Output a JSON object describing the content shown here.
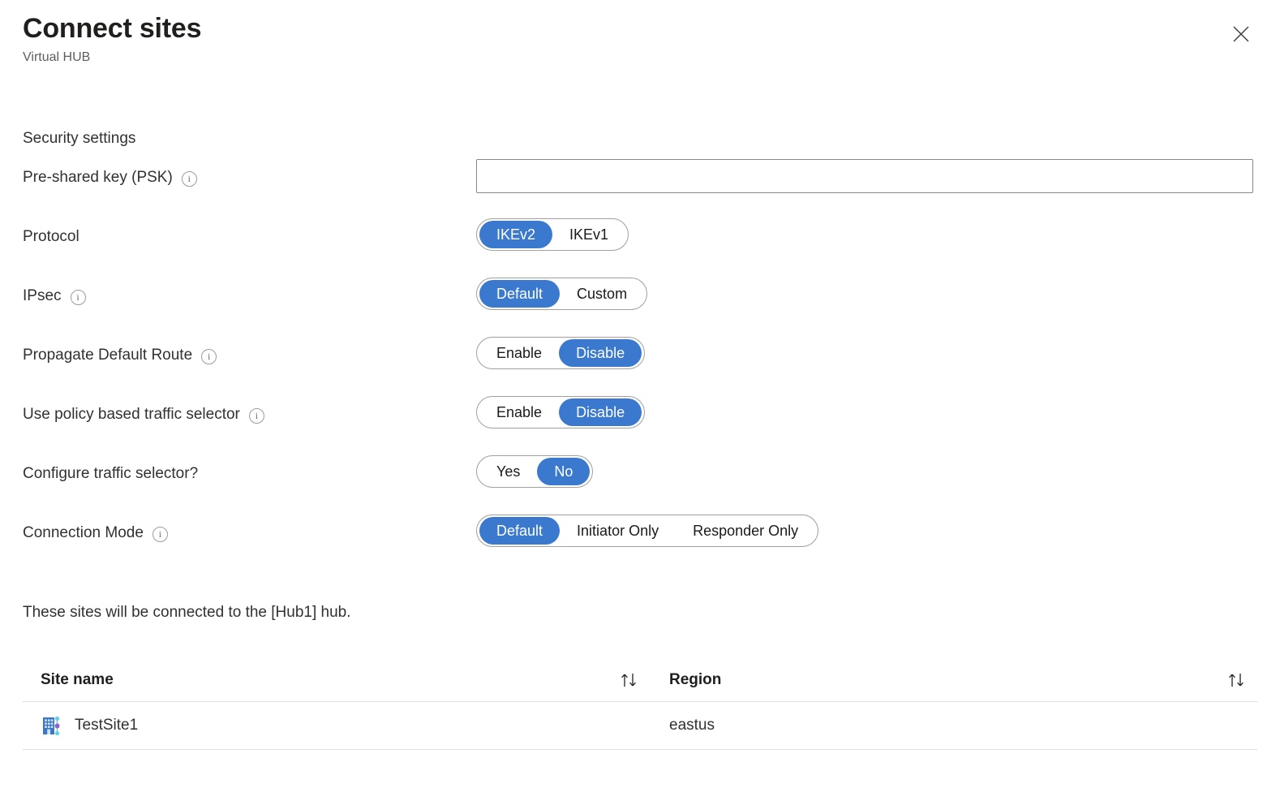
{
  "header": {
    "title": "Connect sites",
    "subtitle": "Virtual HUB",
    "close_label": "Close"
  },
  "section": {
    "heading": "Security settings"
  },
  "fields": {
    "psk": {
      "label": "Pre-shared key (PSK)",
      "value": "",
      "placeholder": "",
      "info": "i"
    },
    "protocol": {
      "label": "Protocol",
      "options": [
        "IKEv2",
        "IKEv1"
      ],
      "selected": "IKEv2"
    },
    "ipsec": {
      "label": "IPsec",
      "info": "i",
      "options": [
        "Default",
        "Custom"
      ],
      "selected": "Default"
    },
    "propagate_default_route": {
      "label": "Propagate Default Route",
      "info": "i",
      "options": [
        "Enable",
        "Disable"
      ],
      "selected": "Disable"
    },
    "policy_based_traffic_selector": {
      "label": "Use policy based traffic selector",
      "info": "i",
      "options": [
        "Enable",
        "Disable"
      ],
      "selected": "Disable"
    },
    "configure_traffic_selector": {
      "label": "Configure traffic selector?",
      "options": [
        "Yes",
        "No"
      ],
      "selected": "No"
    },
    "connection_mode": {
      "label": "Connection Mode",
      "info": "i",
      "options": [
        "Default",
        "Initiator Only",
        "Responder Only"
      ],
      "selected": "Default"
    }
  },
  "sites": {
    "note": "These sites will be connected to the [Hub1] hub.",
    "columns": [
      "Site name",
      "Region"
    ],
    "sort_icon": "sort-arrows-icon",
    "rows": [
      {
        "site_name": "TestSite1",
        "region": "eastus",
        "icon": "vpn-site-icon"
      }
    ]
  },
  "colors": {
    "accent": "#3a79cd",
    "border": "#a19f9d",
    "text": "#323130",
    "muted": "#605e5c",
    "row_divider": "#e1dfdd"
  }
}
